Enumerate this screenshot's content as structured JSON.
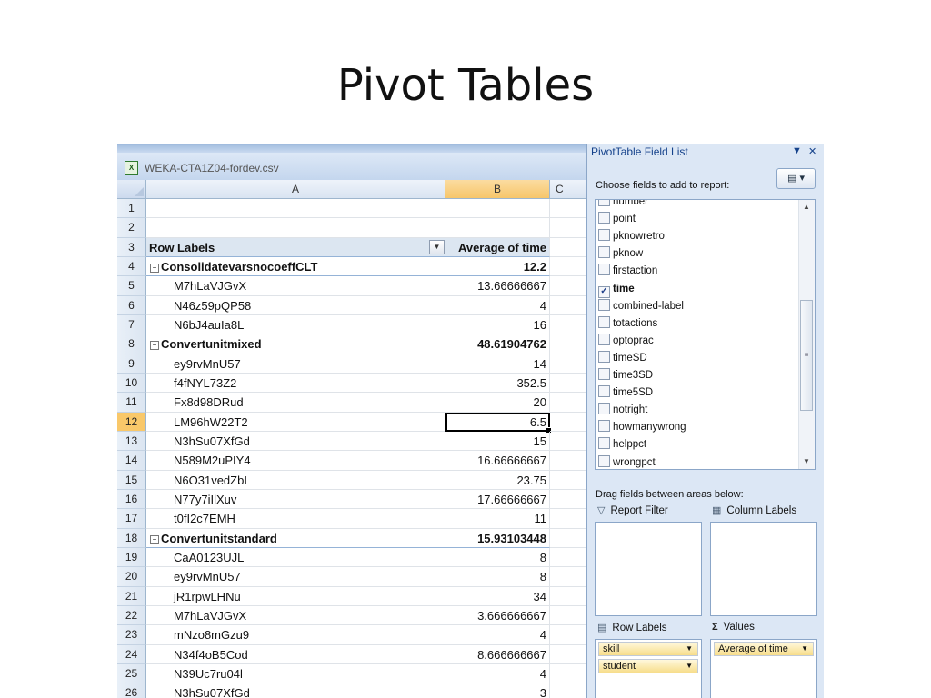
{
  "slide": {
    "title": "Pivot Tables"
  },
  "workbook": {
    "file_name": "WEKA-CTA1Z04-fordev.csv"
  },
  "grid": {
    "columns": [
      "A",
      "B",
      "C"
    ],
    "selected_column": "B",
    "selected_row": "12",
    "header": {
      "row": "3",
      "row_labels": "Row Labels",
      "value_header": "Average of time",
      "filter_glyph": "▼"
    },
    "empty_rows": [
      "1",
      "2"
    ],
    "collapse_glyph": "⊟",
    "rows": [
      {
        "row": "4",
        "type": "group",
        "label": "ConsolidatevarsnocoeffCLT",
        "value": "12.2"
      },
      {
        "row": "5",
        "type": "item",
        "label": "M7hLaVJGvX",
        "value": "13.66666667"
      },
      {
        "row": "6",
        "type": "item",
        "label": "N46z59pQP58",
        "value": "4"
      },
      {
        "row": "7",
        "type": "item",
        "label": "N6bJ4auIa8L",
        "value": "16"
      },
      {
        "row": "8",
        "type": "group",
        "label": "Convertunitmixed",
        "value": "48.61904762"
      },
      {
        "row": "9",
        "type": "item",
        "label": "ey9rvMnU57",
        "value": "14"
      },
      {
        "row": "10",
        "type": "item",
        "label": "f4fNYL73Z2",
        "value": "352.5"
      },
      {
        "row": "11",
        "type": "item",
        "label": "Fx8d98DRud",
        "value": "20"
      },
      {
        "row": "12",
        "type": "item",
        "label": "LM96hW22T2",
        "value": "6.5"
      },
      {
        "row": "13",
        "type": "item",
        "label": "N3hSu07XfGd",
        "value": "15"
      },
      {
        "row": "14",
        "type": "item",
        "label": "N589M2uPIY4",
        "value": "16.66666667"
      },
      {
        "row": "15",
        "type": "item",
        "label": "N6O31vedZbI",
        "value": "23.75"
      },
      {
        "row": "16",
        "type": "item",
        "label": "N77y7iIlXuv",
        "value": "17.66666667"
      },
      {
        "row": "17",
        "type": "item",
        "label": "t0fI2c7EMH",
        "value": "11"
      },
      {
        "row": "18",
        "type": "group",
        "label": "Convertunitstandard",
        "value": "15.93103448"
      },
      {
        "row": "19",
        "type": "item",
        "label": "CaA0123UJL",
        "value": "8"
      },
      {
        "row": "20",
        "type": "item",
        "label": "ey9rvMnU57",
        "value": "8"
      },
      {
        "row": "21",
        "type": "item",
        "label": "jR1rpwLHNu",
        "value": "34"
      },
      {
        "row": "22",
        "type": "item",
        "label": "M7hLaVJGvX",
        "value": "3.666666667"
      },
      {
        "row": "23",
        "type": "item",
        "label": "mNzo8mGzu9",
        "value": "4"
      },
      {
        "row": "24",
        "type": "item",
        "label": "N34f4oB5Cod",
        "value": "8.666666667"
      },
      {
        "row": "25",
        "type": "item",
        "label": "N39Uc7ru04l",
        "value": "4"
      },
      {
        "row": "26",
        "type": "item",
        "label": "N3hSu07XfGd",
        "value": "3"
      }
    ]
  },
  "field_list": {
    "title": "PivotTable Field List",
    "dropdown_glyph": "▼",
    "close_glyph": "✕",
    "choose_text": "Choose fields to add to report:",
    "layout_button": "▤ ▾",
    "fields": [
      {
        "name": "number",
        "checked": false
      },
      {
        "name": "point",
        "checked": false
      },
      {
        "name": "pknowretro",
        "checked": false
      },
      {
        "name": "pknow",
        "checked": false
      },
      {
        "name": "firstaction",
        "checked": false
      },
      {
        "name": "time",
        "checked": true
      },
      {
        "name": "combined-label",
        "checked": false
      },
      {
        "name": "totactions",
        "checked": false
      },
      {
        "name": "optoprac",
        "checked": false
      },
      {
        "name": "timeSD",
        "checked": false
      },
      {
        "name": "time3SD",
        "checked": false
      },
      {
        "name": "time5SD",
        "checked": false
      },
      {
        "name": "notright",
        "checked": false
      },
      {
        "name": "howmanywrong",
        "checked": false
      },
      {
        "name": "helppct",
        "checked": false
      },
      {
        "name": "wrongpct",
        "checked": false
      }
    ],
    "drag_text": "Drag fields between areas below:",
    "areas": {
      "report_filter": {
        "label": "Report Filter",
        "icon": "funnel-icon",
        "glyph": "▽"
      },
      "column_labels": {
        "label": "Column Labels",
        "icon": "table-columns-icon",
        "glyph": "▦"
      },
      "row_labels": {
        "label": "Row Labels",
        "icon": "table-rows-icon",
        "glyph": "▤",
        "items": [
          "skill",
          "student"
        ]
      },
      "values": {
        "label": "Values",
        "icon": "sigma-icon",
        "glyph": "Σ",
        "items": [
          "Average of time"
        ]
      }
    }
  }
}
